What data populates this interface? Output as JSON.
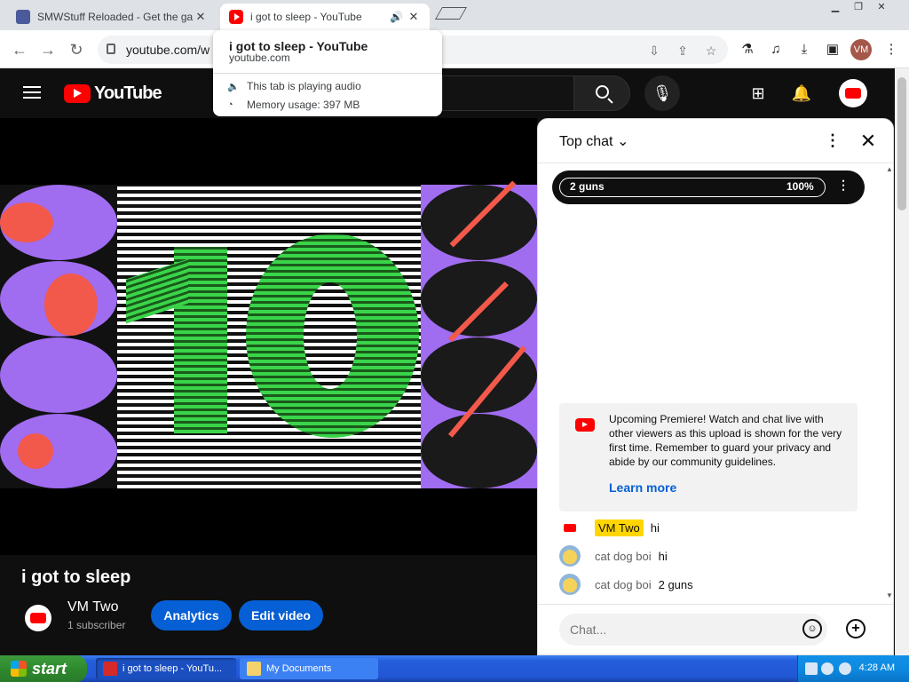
{
  "browser": {
    "tabs": [
      {
        "title": "SMWStuff Reloaded - Get the game"
      },
      {
        "title": "i got to sleep - YouTube"
      }
    ],
    "url": "youtube.com/w",
    "profile_initials": "VM"
  },
  "hovercard": {
    "title": "i got to sleep - YouTube",
    "domain": "youtube.com",
    "audio_status": "This tab is playing audio",
    "memory": "Memory usage: 397 MB"
  },
  "youtube": {
    "logo_text": "YouTube"
  },
  "video": {
    "title": "i got to sleep",
    "channel_name": "VM Two",
    "subscribers": "1 subscriber",
    "analytics_label": "Analytics",
    "edit_label": "Edit video"
  },
  "chat": {
    "header": "Top chat",
    "poll": {
      "option": "2 guns",
      "percent": "100%"
    },
    "notice": {
      "message": "Upcoming Premiere! Watch and chat live with other viewers as this upload is shown for the very first time. Remember to guard your privacy and abide by our community guidelines.",
      "link": "Learn more"
    },
    "messages": [
      {
        "author": "VM Two",
        "text": "hi"
      },
      {
        "author": "cat dog boi",
        "text": "hi"
      },
      {
        "author": "cat dog boi",
        "text": "2 guns"
      }
    ],
    "input_placeholder": "Chat..."
  },
  "taskbar": {
    "start_label": "start",
    "items": [
      {
        "label": "i got to sleep - YouTu..."
      },
      {
        "label": "My Documents"
      }
    ],
    "clock": "4:28 AM"
  },
  "colors": {
    "yt_red": "#ff0000",
    "accent_blue": "#065fd4",
    "owner_badge": "#ffd600",
    "xp_taskbar": "#245edb",
    "xp_start": "#2e8a2e"
  }
}
